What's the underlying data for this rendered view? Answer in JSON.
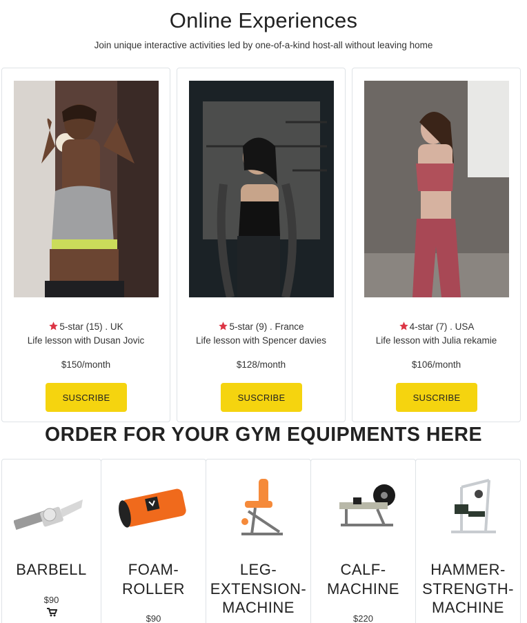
{
  "header": {
    "title": "Online Experiences",
    "subtitle": "Join unique interactive activities led by one-of-a-kind host-all without leaving home"
  },
  "experiences": [
    {
      "rating": "5-star (15) . UK",
      "lesson": "Life lesson with Dusan Jovic",
      "price": "$150/month",
      "button": "SUSCRIBE"
    },
    {
      "rating": "5-star (9) . France",
      "lesson": "Life lesson with Spencer davies",
      "price": "$128/month",
      "button": "SUSCRIBE"
    },
    {
      "rating": "4-star (7) . USA",
      "lesson": "Life lesson with Julia rekamie",
      "price": "$106/month",
      "button": "SUSCRIBE"
    }
  ],
  "equipment_section": {
    "title": "ORDER FOR YOUR GYM EQUIPMENTS HERE",
    "items": [
      {
        "name": "BARBELL",
        "price": "$90"
      },
      {
        "name": "FOAM-\nROLLER",
        "price": "$90"
      },
      {
        "name": "LEG-\nEXTENSION-\nMACHINE",
        "price": ""
      },
      {
        "name": "CALF-\nMACHINE",
        "price": "$220"
      },
      {
        "name": "HAMMER-\nSTRENGTH-\nMACHINE",
        "price": ""
      }
    ]
  },
  "colors": {
    "accent": "#f5d40f",
    "star": "#dc3545",
    "border": "#dee2e6"
  }
}
